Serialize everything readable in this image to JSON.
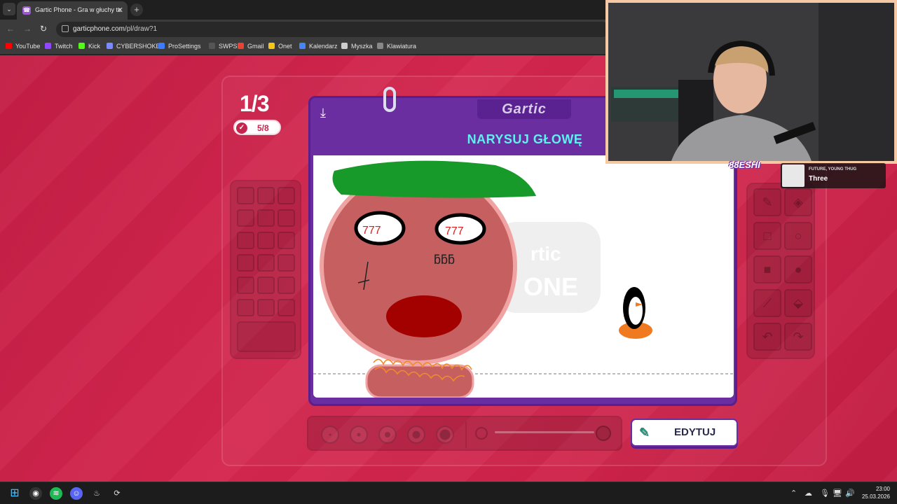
{
  "browser": {
    "tab_title": "Gartic Phone - Gra w głuchy te",
    "tab_close": "✕",
    "new_tab": "+",
    "url_prefix": "garticphone.com",
    "url_path": "/pl/draw?1",
    "bookmarks": [
      {
        "label": "YouTube",
        "color": "#ff0000"
      },
      {
        "label": "Twitch",
        "color": "#9146ff"
      },
      {
        "label": "Kick",
        "color": "#53fc18"
      },
      {
        "label": "CYBERSHOKE",
        "color": "#7a8bff"
      },
      {
        "label": "ProSettings",
        "color": "#3d7bff"
      },
      {
        "label": "SWPS",
        "color": "#555555"
      },
      {
        "label": "Gmail",
        "color": "#ea4335"
      },
      {
        "label": "Onet",
        "color": "#f5c518"
      },
      {
        "label": "Kalendarz",
        "color": "#4285f4"
      },
      {
        "label": "Myszka",
        "color": "#cccccc"
      },
      {
        "label": "Klawiatura",
        "color": "#888888"
      }
    ]
  },
  "game": {
    "round": "1/3",
    "done_count": "5/8",
    "logo": "Gartic",
    "task": "NARYSUJ GŁOWĘ",
    "edit_button": "EDYTUJ",
    "accent": "#6b2ea0",
    "task_color": "#5ff0f0",
    "background": "#d4264e"
  },
  "drawing": {
    "eye_text": "777",
    "scribble_text": "ƃƃƃ"
  },
  "stream": {
    "nameplate": "88ESHI",
    "now_playing_artist": "FUTURE, YOUNG THUG",
    "now_playing_song": "Three"
  },
  "taskbar": {
    "time": "23:00",
    "date": "25.03.2026"
  }
}
